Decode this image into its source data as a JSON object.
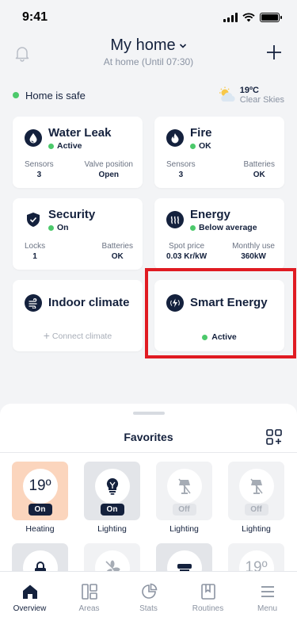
{
  "status_bar": {
    "time": "9:41"
  },
  "header": {
    "title": "My home",
    "subtitle": "At home (Until 07:30)"
  },
  "home_status": {
    "text": "Home is safe",
    "color": "#4cc96b"
  },
  "weather": {
    "temp": "19ºC",
    "condition": "Clear Skies",
    "icon": "partly-cloudy-icon"
  },
  "cards": {
    "water_leak": {
      "title": "Water Leak",
      "status": "Active",
      "m1_label": "Sensors",
      "m1_value": "3",
      "m2_label": "Valve position",
      "m2_value": "Open"
    },
    "fire": {
      "title": "Fire",
      "status": "OK",
      "m1_label": "Sensors",
      "m1_value": "3",
      "m2_label": "Batteries",
      "m2_value": "OK"
    },
    "security": {
      "title": "Security",
      "status": "On",
      "m1_label": "Locks",
      "m1_value": "1",
      "m2_label": "Batteries",
      "m2_value": "OK"
    },
    "energy": {
      "title": "Energy",
      "status": "Below average",
      "m1_label": "Spot price",
      "m1_value": "0.03 Kr/kW",
      "m2_label": "Monthly use",
      "m2_value": "360kW"
    },
    "indoor_climate": {
      "title": "Indoor climate",
      "action": "Connect climate"
    },
    "smart_energy": {
      "title": "Smart Energy",
      "status": "Active"
    }
  },
  "favorites": {
    "title": "Favorites",
    "tiles": [
      {
        "label": "Heating",
        "value": "19º",
        "state": "On"
      },
      {
        "label": "Lighting",
        "state": "On"
      },
      {
        "label": "Lighting",
        "state": "Off"
      },
      {
        "label": "Lighting",
        "state": "Off"
      }
    ],
    "tiles_row2": [
      {
        "value": "19º"
      }
    ]
  },
  "tabs": [
    {
      "label": "Overview",
      "icon": "home-icon"
    },
    {
      "label": "Areas",
      "icon": "areas-icon"
    },
    {
      "label": "Stats",
      "icon": "pie-chart-icon"
    },
    {
      "label": "Routines",
      "icon": "book-icon"
    },
    {
      "label": "Menu",
      "icon": "menu-icon"
    }
  ],
  "colors": {
    "navy": "#14213d",
    "green": "#4cc96b",
    "highlight": "#e01b22",
    "heating": "#fbd5bd"
  }
}
